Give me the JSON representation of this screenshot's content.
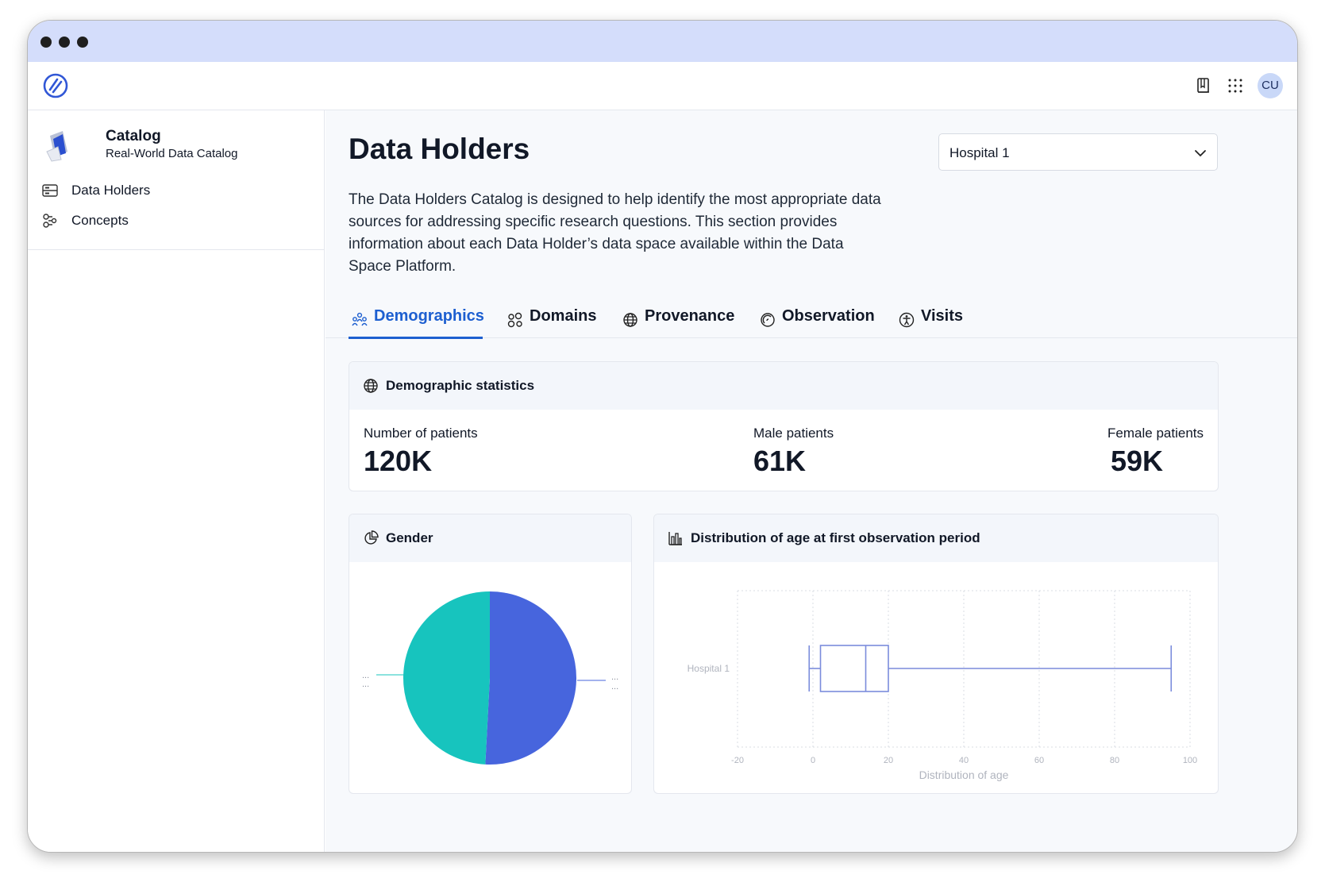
{
  "app": {
    "avatar_initials": "CU",
    "header_icons": [
      "book-icon",
      "apps-grid-icon"
    ]
  },
  "sidebar": {
    "title": "Catalog",
    "subtitle": "Real-World Data Catalog",
    "items": [
      {
        "label": "Data Holders",
        "icon": "database-icon"
      },
      {
        "label": "Concepts",
        "icon": "concepts-icon"
      }
    ]
  },
  "main": {
    "title": "Data Holders",
    "selected_holder": "Hospital 1",
    "description": "The Data Holders Catalog is designed to help identify the most appropriate data sources for addressing specific research questions. This section provides information about each Data Holder’s data space available within the Data Space Platform.",
    "tabs": [
      {
        "label": "Demographics",
        "icon": "people-icon",
        "active": true
      },
      {
        "label": "Domains",
        "icon": "domains-icon",
        "active": false
      },
      {
        "label": "Provenance",
        "icon": "globe-icon",
        "active": false
      },
      {
        "label": "Observation",
        "icon": "observation-icon",
        "active": false
      },
      {
        "label": "Visits",
        "icon": "accessibility-icon",
        "active": false
      }
    ]
  },
  "stats": {
    "title": "Demographic statistics",
    "items": [
      {
        "label": "Number of patients",
        "value": "120K"
      },
      {
        "label": "Male patients",
        "value": "61K"
      },
      {
        "label": "Female patients",
        "value": "59K"
      }
    ]
  },
  "gender_card": {
    "title": "Gender",
    "left_label": "...",
    "right_label": "..."
  },
  "age_card": {
    "title": "Distribution of age at first observation period"
  },
  "colors": {
    "accent": "#1d5fd0",
    "male": "#4765dd",
    "female": "#17c4be",
    "boxplot": "#7b8cdc"
  },
  "chart_data": [
    {
      "type": "pie",
      "title": "Gender",
      "slices": [
        {
          "label": "...",
          "value": 61,
          "color": "#4765dd"
        },
        {
          "label": "...",
          "value": 59,
          "color": "#17c4be"
        }
      ]
    },
    {
      "type": "boxplot",
      "title": "Distribution of age at first observation period",
      "xlabel": "Distribution of age",
      "categories": [
        "Hospital 1"
      ],
      "xlim": [
        -20,
        100
      ],
      "xticks": [
        -20,
        0,
        20,
        40,
        60,
        80,
        100
      ],
      "grid": true,
      "boxes": [
        {
          "name": "Hospital 1",
          "min": -1,
          "q1": 2,
          "median": 14,
          "q3": 20,
          "max": 95
        }
      ]
    }
  ]
}
